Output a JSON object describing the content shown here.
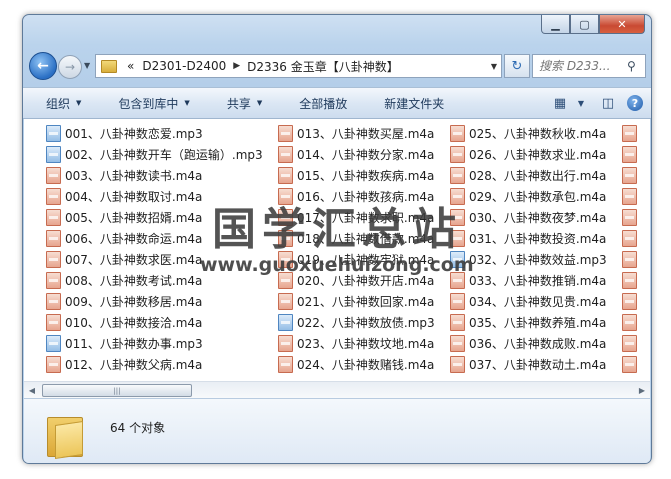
{
  "window": {
    "caption": {
      "minimize": "▁",
      "maximize": "▢",
      "close": "✕"
    }
  },
  "nav": {
    "back": "←",
    "forward": "→"
  },
  "address": {
    "overflow": "«",
    "segments": [
      "D2301-D2400",
      "D2336 金玉章【八卦神数】"
    ]
  },
  "search": {
    "placeholder": "搜索 D233..."
  },
  "toolbar": {
    "organize": "组织",
    "include_in_library": "包含到库中",
    "share": "共享",
    "play_all": "全部播放",
    "new_folder": "新建文件夹"
  },
  "files": {
    "col1": [
      {
        "name": "001、八卦神数恋爱.mp3",
        "type": "mp3"
      },
      {
        "name": "002、八卦神数开车（跑运输）.mp3",
        "type": "mp3"
      },
      {
        "name": "003、八卦神数读书.m4a",
        "type": "m4a"
      },
      {
        "name": "004、八卦神数取讨.m4a",
        "type": "m4a"
      },
      {
        "name": "005、八卦神数招婿.m4a",
        "type": "m4a"
      },
      {
        "name": "006、八卦神数命运.m4a",
        "type": "m4a"
      },
      {
        "name": "007、八卦神数求医.m4a",
        "type": "m4a"
      },
      {
        "name": "008、八卦神数考试.m4a",
        "type": "m4a"
      },
      {
        "name": "009、八卦神数移居.m4a",
        "type": "m4a"
      },
      {
        "name": "010、八卦神数接洽.m4a",
        "type": "m4a"
      },
      {
        "name": "011、八卦神数办事.mp3",
        "type": "mp3"
      },
      {
        "name": "012、八卦神数父病.m4a",
        "type": "m4a"
      }
    ],
    "col2": [
      {
        "name": "013、八卦神数买屋.m4a",
        "type": "m4a"
      },
      {
        "name": "014、八卦神数分家.m4a",
        "type": "m4a"
      },
      {
        "name": "015、八卦神数疾病.m4a",
        "type": "m4a"
      },
      {
        "name": "016、八卦神数孩病.m4a",
        "type": "m4a"
      },
      {
        "name": "017、八卦神数求职.m4a",
        "type": "m4a"
      },
      {
        "name": "018、八卦神数借款.m4a",
        "type": "m4a"
      },
      {
        "name": "019、八卦神数牢狱.m4a",
        "type": "m4a"
      },
      {
        "name": "020、八卦神数开店.m4a",
        "type": "m4a"
      },
      {
        "name": "021、八卦神数回家.m4a",
        "type": "m4a"
      },
      {
        "name": "022、八卦神数放债.mp3",
        "type": "mp3"
      },
      {
        "name": "023、八卦神数坟地.m4a",
        "type": "m4a"
      },
      {
        "name": "024、八卦神数赌钱.m4a",
        "type": "m4a"
      }
    ],
    "col3": [
      {
        "name": "025、八卦神数秋收.m4a",
        "type": "m4a"
      },
      {
        "name": "026、八卦神数求业.m4a",
        "type": "m4a"
      },
      {
        "name": "028、八卦神数出行.m4a",
        "type": "m4a"
      },
      {
        "name": "029、八卦神数承包.m4a",
        "type": "m4a"
      },
      {
        "name": "030、八卦神数夜梦.m4a",
        "type": "m4a"
      },
      {
        "name": "031、八卦神数投资.m4a",
        "type": "m4a"
      },
      {
        "name": "032、八卦神数效益.mp3",
        "type": "mp3"
      },
      {
        "name": "033、八卦神数推销.m4a",
        "type": "m4a"
      },
      {
        "name": "034、八卦神数见贵.m4a",
        "type": "m4a"
      },
      {
        "name": "035、八卦神数养殖.m4a",
        "type": "m4a"
      },
      {
        "name": "036、八卦神数成败.m4a",
        "type": "m4a"
      },
      {
        "name": "037、八卦神数动土.m4a",
        "type": "m4a"
      }
    ]
  },
  "status": {
    "count": "64 个对象"
  },
  "watermark": {
    "cn": "国学汇总站",
    "url": "www.guoxuehuizong.com"
  },
  "colors": {
    "m4a_icon": "#e7a58f",
    "mp3_icon": "#94bde6",
    "frame": "#b3cde8"
  }
}
